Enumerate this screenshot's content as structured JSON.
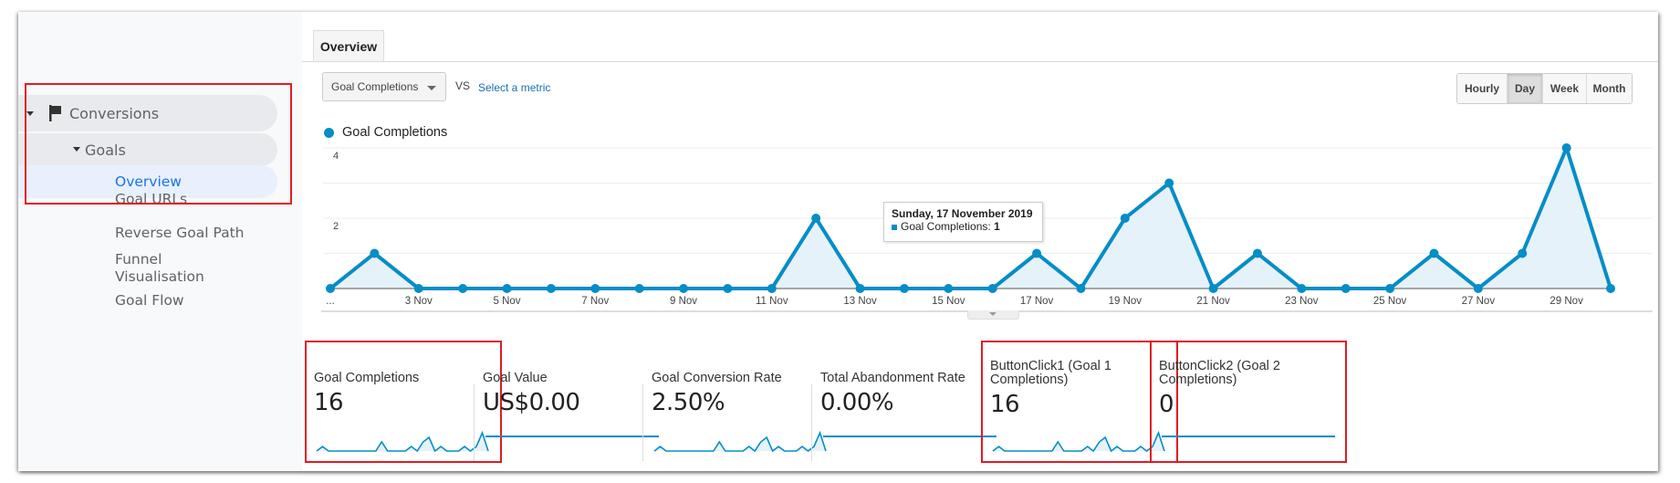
{
  "sidebar": {
    "conversions": {
      "label": "Conversions",
      "icon": "flag-icon"
    },
    "goals": {
      "label": "Goals"
    },
    "items": [
      {
        "label": "Overview",
        "active": true
      },
      {
        "label": "Goal URLs"
      },
      {
        "label": "Reverse Goal Path"
      },
      {
        "label": "Funnel Visualisation"
      },
      {
        "label": "Goal Flow"
      }
    ]
  },
  "tabs": [
    {
      "label": "Overview",
      "active": true
    }
  ],
  "controls": {
    "metric_select": "Goal Completions",
    "vs_label": "VS",
    "select_metric_link": "Select a metric",
    "granularity": [
      {
        "label": "Hourly",
        "active": false
      },
      {
        "label": "Day",
        "active": true
      },
      {
        "label": "Week",
        "active": false
      },
      {
        "label": "Month",
        "active": false
      }
    ]
  },
  "colors": {
    "series": "#058dc7",
    "fill": "#e5f2f9",
    "highlight_box": "#e11b22"
  },
  "tooltip": {
    "title": "Sunday, 17 November 2019",
    "series_label": "Goal Completions:",
    "value": "1"
  },
  "chart_data": {
    "type": "area",
    "title": "",
    "legend": [
      "Goal Completions"
    ],
    "legend_position": "top-left",
    "xlabel": "",
    "ylabel": "",
    "ylim": [
      0,
      4
    ],
    "y_ticks": [
      "2",
      "4"
    ],
    "x_tick_labels": [
      "...",
      "3 Nov",
      "5 Nov",
      "7 Nov",
      "9 Nov",
      "11 Nov",
      "13 Nov",
      "15 Nov",
      "17 Nov",
      "19 Nov",
      "21 Nov",
      "23 Nov",
      "25 Nov",
      "27 Nov",
      "29 Nov"
    ],
    "x": [
      "1 Nov",
      "2 Nov",
      "3 Nov",
      "4 Nov",
      "5 Nov",
      "6 Nov",
      "7 Nov",
      "8 Nov",
      "9 Nov",
      "10 Nov",
      "11 Nov",
      "12 Nov",
      "13 Nov",
      "14 Nov",
      "15 Nov",
      "16 Nov",
      "17 Nov",
      "18 Nov",
      "19 Nov",
      "20 Nov",
      "21 Nov",
      "22 Nov",
      "23 Nov",
      "24 Nov",
      "25 Nov",
      "26 Nov",
      "27 Nov",
      "28 Nov",
      "29 Nov",
      "30 Nov"
    ],
    "series": [
      {
        "name": "Goal Completions",
        "values": [
          0,
          1,
          0,
          0,
          0,
          0,
          0,
          0,
          0,
          0,
          0,
          2,
          0,
          0,
          0,
          0,
          1,
          0,
          2,
          3,
          0,
          1,
          0,
          0,
          0,
          1,
          0,
          1,
          4,
          0
        ]
      }
    ],
    "grid": true
  },
  "scorecards": [
    {
      "label": "Goal Completions",
      "value": "16",
      "sparkline": "series",
      "highlighted": true
    },
    {
      "label": "Goal Value",
      "value": "US$0.00",
      "sparkline": "flat",
      "highlighted": false
    },
    {
      "label": "Goal Conversion Rate",
      "value": "2.50%",
      "sparkline": "series",
      "highlighted": false
    },
    {
      "label": "Total Abandonment Rate",
      "value": "0.00%",
      "sparkline": "flat",
      "highlighted": false
    },
    {
      "label": "ButtonClick1 (Goal 1 Completions)",
      "value": "16",
      "sparkline": "series",
      "highlighted": true
    },
    {
      "label": "ButtonClick2 (Goal 2 Completions)",
      "value": "0",
      "sparkline": "flat",
      "highlighted": true
    }
  ]
}
